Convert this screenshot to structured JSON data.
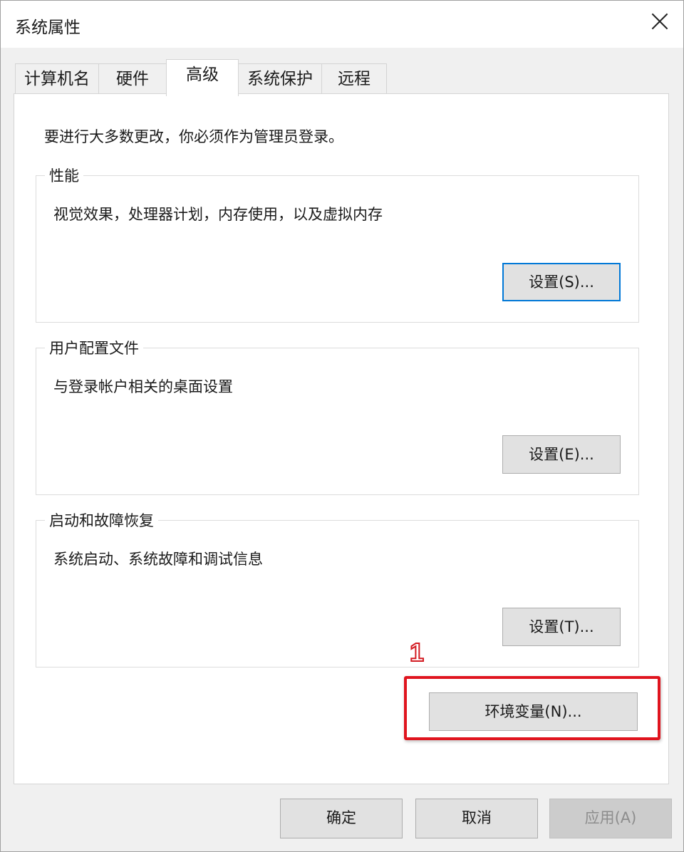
{
  "window": {
    "title": "系统属性"
  },
  "tabs": [
    {
      "label": "计算机名"
    },
    {
      "label": "硬件"
    },
    {
      "label": "高级"
    },
    {
      "label": "系统保护"
    },
    {
      "label": "远程"
    }
  ],
  "panel": {
    "admin_note": "要进行大多数更改，你必须作为管理员登录。",
    "groups": [
      {
        "title": "性能",
        "description": "视觉效果，处理器计划，内存使用，以及虚拟内存",
        "button": "设置(S)..."
      },
      {
        "title": "用户配置文件",
        "description": "与登录帐户相关的桌面设置",
        "button": "设置(E)..."
      },
      {
        "title": "启动和故障恢复",
        "description": "系统启动、系统故障和调试信息",
        "button": "设置(T)..."
      }
    ],
    "env_button": "环境变量(N)..."
  },
  "annotation": {
    "marker": "1",
    "color": "#e0141e"
  },
  "footer": {
    "ok": "确定",
    "cancel": "取消",
    "apply": "应用(A)"
  },
  "colors": {
    "accent": "#0078d7",
    "window_bg": "#f0f0f0"
  }
}
